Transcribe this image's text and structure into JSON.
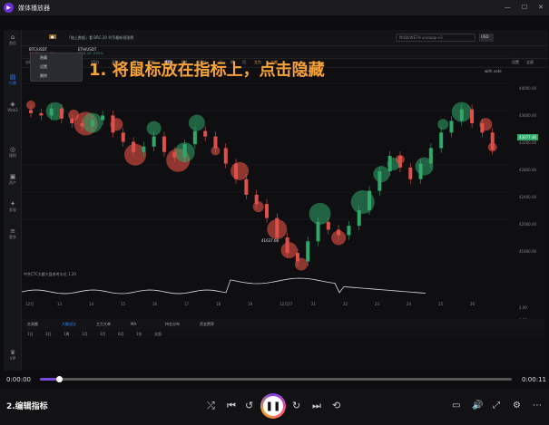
{
  "player": {
    "app_title": "媒体播放器",
    "logo_glyph": "▶",
    "window_buttons": [
      "—",
      "☐",
      "✕"
    ]
  },
  "sidebar": [
    {
      "label": "首页",
      "icon": "home-icon",
      "glyph": "⌂",
      "active": false
    },
    {
      "label": "行情",
      "icon": "chart-icon",
      "glyph": "▤",
      "active": true
    },
    {
      "label": "Web3",
      "icon": "web3-icon",
      "glyph": "◈",
      "active": false
    },
    {
      "label": "理财",
      "icon": "coin-icon",
      "glyph": "◎",
      "active": false
    },
    {
      "label": "资产",
      "icon": "wallet-icon",
      "glyph": "▣",
      "active": false
    },
    {
      "label": "发现",
      "icon": "discover-icon",
      "glyph": "✦",
      "active": false
    },
    {
      "label": "更多",
      "icon": "more-icon",
      "glyph": "≡",
      "active": false
    },
    {
      "label": "VIP",
      "icon": "vip-icon",
      "glyph": "♛",
      "active": false
    }
  ],
  "appbar": {
    "tag": "●",
    "news": "「链上数据」看 BRC-20 代币最新领涨榜",
    "search_placeholder": "MUBI/WETH uniswap-v3",
    "currency": "USD"
  },
  "symbols": [
    {
      "name": "BTC/USDT",
      "price": "43077.46 -1.35%"
    },
    {
      "name": "ETH/USDT",
      "price": "2351.29 -0.91%"
    }
  ],
  "toolbar": {
    "items": [
      "分时",
      "1分",
      "3分",
      "5分",
      "15分",
      "30分",
      "1时",
      "2时",
      "4时",
      "6时",
      "12时",
      "日",
      "周",
      "月",
      "主力",
      "大额"
    ],
    "right": [
      "设置",
      "全屏"
    ],
    "indicator_tag": "with vote"
  },
  "context_menu": [
    "隐藏",
    "设置",
    "删除"
  ],
  "annotation": "1. 将鼠标放在指标上，点击隐藏",
  "chart": {
    "last_price": "43077.46",
    "low_label": "41637.60",
    "y_labels": [
      "44000.00",
      "43600.00",
      "43200.00",
      "42800.00",
      "42400.00",
      "42000.00",
      "41600.00",
      "2.00",
      "1.50",
      "1.00"
    ],
    "x_labels": [
      "12月",
      "13",
      "14",
      "15",
      "16",
      "17",
      "18",
      "19",
      "12月27",
      "21",
      "22",
      "23",
      "24",
      "25",
      "26"
    ],
    "indicator_label": "中共CTC大额大盘参考水位 1.20"
  },
  "bottom_tabs": [
    "交易额",
    "大额成交",
    "主力大单",
    "MA",
    "持仓分布",
    "资金费率"
  ],
  "bottom_tabs2": [
    "1日",
    "3日",
    "1周",
    "1月",
    "3月",
    "6月",
    "1年",
    "全部"
  ],
  "playback": {
    "current": "0:00:00",
    "total": "0:00:11",
    "progress_pct": 4
  },
  "controls": {
    "title": "2.编辑指标"
  },
  "chart_data": {
    "type": "candlestick",
    "y_range": [
      41600,
      44400
    ],
    "close_series": [
      43550,
      43520,
      43610,
      43480,
      43420,
      43380,
      43460,
      43520,
      43300,
      43180,
      43050,
      43120,
      43250,
      43050,
      42980,
      43150,
      43320,
      43250,
      43100,
      42900,
      42700,
      42500,
      42380,
      42200,
      41950,
      41750,
      41640,
      41900,
      42150,
      42050,
      41980,
      42100,
      42300,
      42550,
      42800,
      43000,
      42850,
      42700,
      42900,
      43100,
      43300,
      43450,
      43600,
      43420,
      43300,
      43077
    ]
  }
}
